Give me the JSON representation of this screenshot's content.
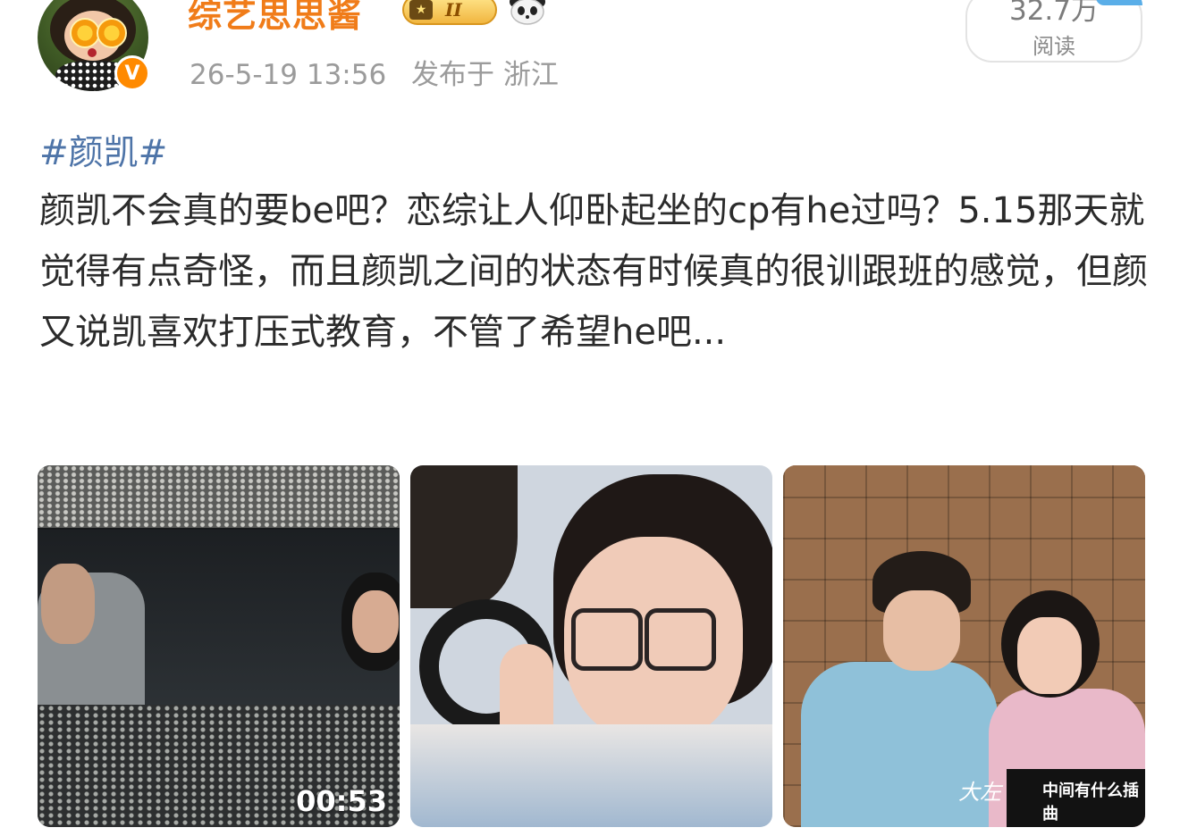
{
  "user": {
    "name": "综艺思思酱",
    "rank_numeral": "II",
    "post_date": "26-5-19 13:56",
    "location": "发布于 浙江"
  },
  "reads": {
    "count": "32.7万",
    "label": "阅读"
  },
  "post": {
    "topic": "#颜凯#",
    "text": "颜凯不会真的要be吧？恋综让人仰卧起坐的cp有he过吗？5.15那天就觉得有点奇怪，而且颜凯之间的状态有时候真的很训跟班的感觉，但颜又说凯喜欢打压式教育，不管了希望he吧..."
  },
  "media": {
    "video_duration": "00:53",
    "thumb3_caption_left": "大左",
    "thumb3_caption_right": "中间有什么插曲"
  },
  "colors": {
    "username": "#f07c19",
    "topic": "#4e74a8",
    "meta": "#9b9b9b"
  },
  "icons": [
    "verified-v-icon",
    "rank-crown-icon",
    "panda-icon"
  ]
}
